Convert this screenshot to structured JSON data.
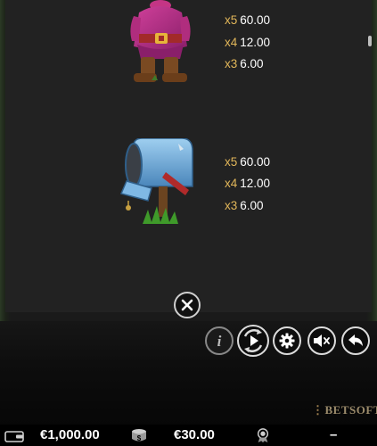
{
  "paytable": {
    "symbols": [
      {
        "icon": "dwarf-icon",
        "payouts": [
          {
            "multiplier": "x5",
            "amount": "60.00"
          },
          {
            "multiplier": "x4",
            "amount": "12.00"
          },
          {
            "multiplier": "x3",
            "amount": "6.00"
          }
        ]
      },
      {
        "icon": "mailbox-icon",
        "payouts": [
          {
            "multiplier": "x5",
            "amount": "60.00"
          },
          {
            "multiplier": "x4",
            "amount": "12.00"
          },
          {
            "multiplier": "x3",
            "amount": "6.00"
          }
        ]
      }
    ]
  },
  "controls": {
    "close_icon": "close-icon",
    "info_icon": "info-icon",
    "spin_icon": "spin-icon",
    "settings_icon": "gear-icon",
    "sound_icon": "sound-muted-icon",
    "back_icon": "back-arrow-icon"
  },
  "brand": {
    "logo": "BETSOFT"
  },
  "status_bar": {
    "balance": "€1,000.00",
    "bet": "€30.00",
    "win": "–"
  },
  "colors": {
    "multiplier": "#e2b75a",
    "text": "#ffffff"
  }
}
